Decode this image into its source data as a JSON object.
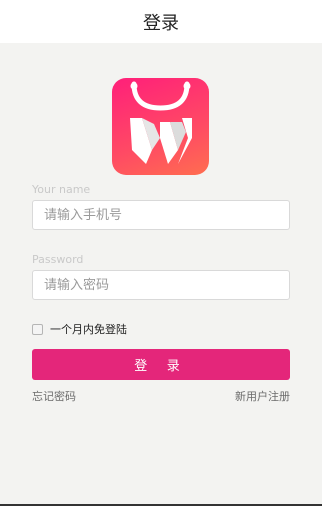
{
  "header": {
    "title": "登录"
  },
  "form": {
    "name_label": "Your name",
    "name_placeholder": "请输入手机号",
    "password_label": "Password",
    "password_placeholder": "请输入密码",
    "remember_label": "一个月内免登陆",
    "login_button": "登 录",
    "forgot_password": "忘记密码",
    "register": "新用户注册"
  },
  "colors": {
    "accent": "#e4267a",
    "background": "#f3f3f1"
  },
  "icons": {
    "logo": "shopping-bag-w-logo-icon"
  }
}
